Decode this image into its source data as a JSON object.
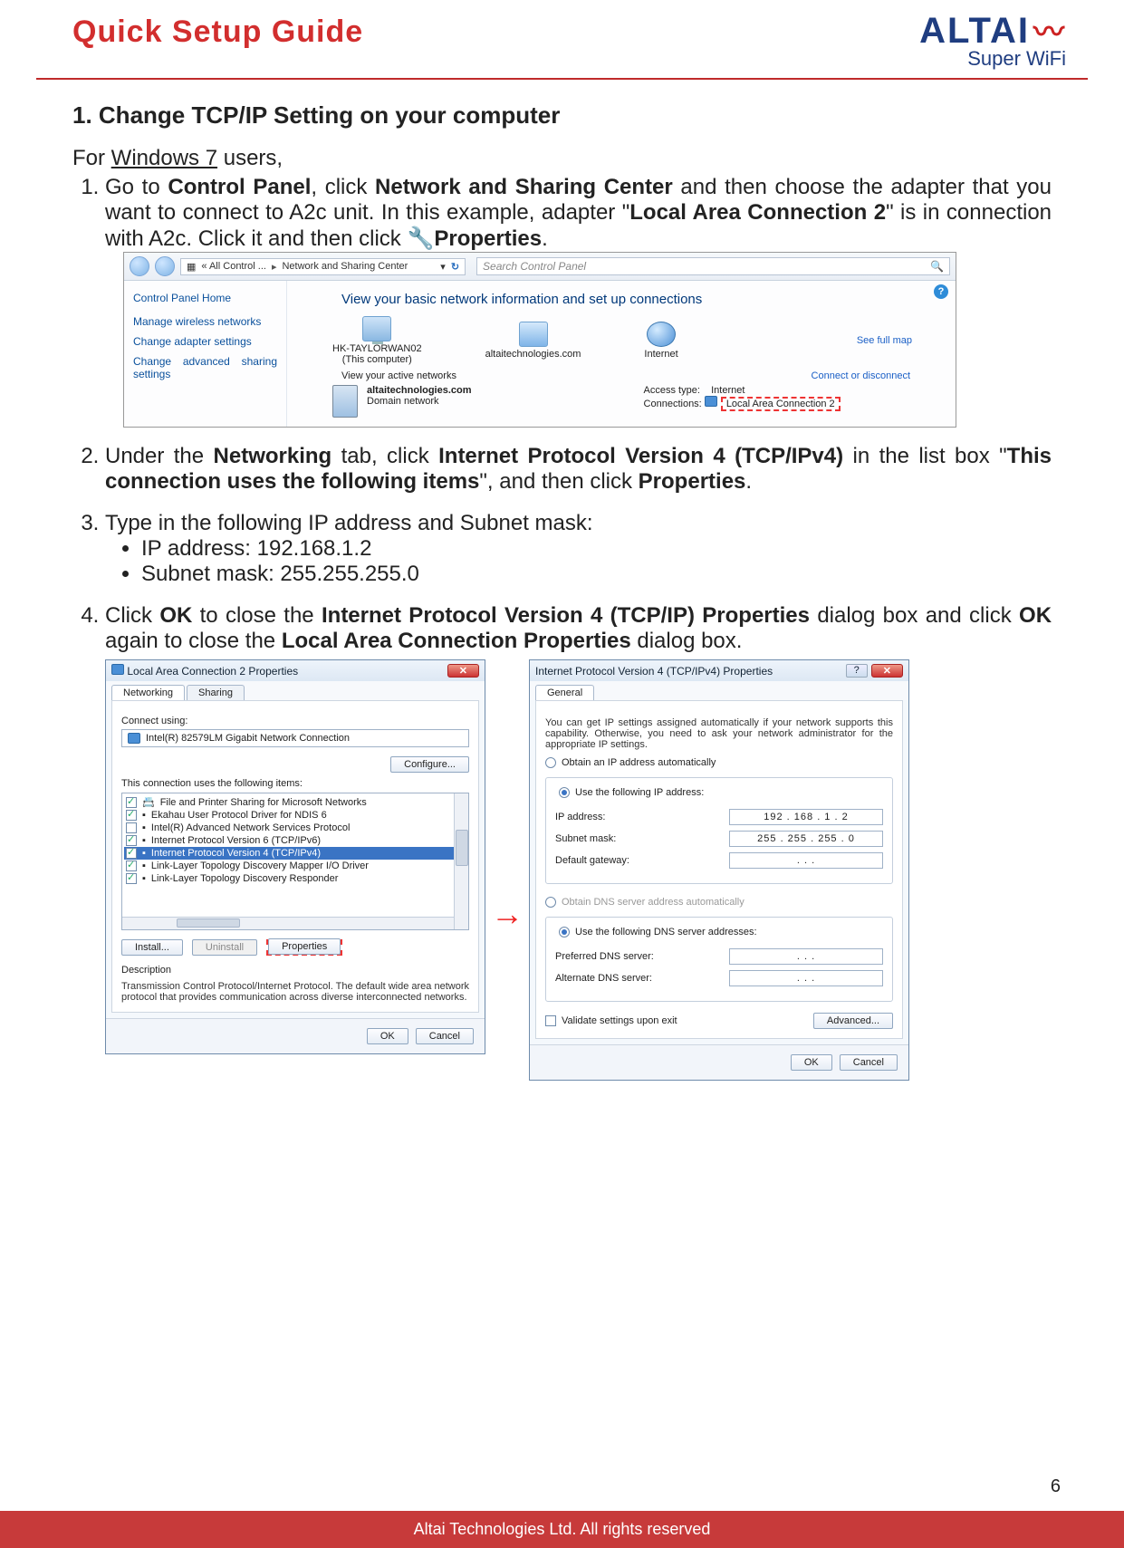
{
  "header": {
    "title": "Quick Setup Guide",
    "brand": "ALTAI",
    "brand_sub": "Super WiFi"
  },
  "section": {
    "heading": "1. Change TCP/IP Setting on your computer"
  },
  "intro": {
    "prefix": "For ",
    "os": "Windows 7",
    "suffix": " users,"
  },
  "step1": {
    "text_a": "Go to ",
    "b1": "Control Panel",
    "text_b": ", click ",
    "b2": "Network and Sharing Center",
    "text_c": " and then choose the adapter that you want to connect to A2c unit. In this example, adapter \"",
    "b3": "Local Area Connection 2",
    "text_d": "\" is in connection with A2c. Click it and then click ",
    "b4": "Properties",
    "text_e": "."
  },
  "ss1": {
    "breadcrumb_a": "« All Control ...",
    "breadcrumb_b": "Network and Sharing Center",
    "search_ph": "Search Control Panel",
    "side": {
      "home": "Control Panel Home",
      "l1": "Manage wireless networks",
      "l2": "Change adapter settings",
      "l3": "Change advanced sharing settings"
    },
    "main_title": "View your basic network information and set up connections",
    "see_map": "See full map",
    "n1_a": "HK-TAYLORWAN02",
    "n1_b": "(This computer)",
    "n2": "altaitechnologies.com",
    "n3": "Internet",
    "view_active": "View your active networks",
    "connect_link": "Connect or disconnect",
    "dom": "altaitechnologies.com",
    "dom_sub": "Domain network",
    "access_lbl": "Access type:",
    "access_val": "Internet",
    "conn_lbl": "Connections:",
    "conn_val": "Local Area Connection 2"
  },
  "step2": {
    "text_a": "Under the ",
    "b1": "Networking",
    "text_b": " tab, click ",
    "b2": "Internet Protocol Version 4 (TCP/IPv4)",
    "text_c": " in the list box \"",
    "b3": "This connection uses the following items",
    "text_d": "\", and then click ",
    "b4": "Properties",
    "text_e": "."
  },
  "step3": {
    "text": "Type in the following IP address and Subnet mask:",
    "ip_lbl": "IP address: 192.168.1.2",
    "mask_lbl": "Subnet mask: 255.255.255.0"
  },
  "step4": {
    "text_a": "Click ",
    "b1": "OK",
    "text_b": " to close the ",
    "b2": "Internet Protocol Version 4 (TCP/IP) Properties",
    "text_c": " dialog box and click ",
    "b3": "OK",
    "text_d": " again to close the ",
    "b4": "Local Area Connection Properties",
    "text_e": " dialog box."
  },
  "ss2": {
    "title": "Local Area Connection 2 Properties",
    "tab1": "Networking",
    "tab2": "Sharing",
    "connect_using": "Connect using:",
    "nic": "Intel(R) 82579LM Gigabit Network Connection",
    "configure": "Configure...",
    "items_lbl": "This connection uses the following items:",
    "items": [
      "File and Printer Sharing for Microsoft Networks",
      "Ekahau User Protocol Driver for NDIS 6",
      "Intel(R) Advanced Network Services Protocol",
      "Internet Protocol Version 6 (TCP/IPv6)",
      "Internet Protocol Version 4 (TCP/IPv4)",
      "Link-Layer Topology Discovery Mapper I/O Driver",
      "Link-Layer Topology Discovery Responder"
    ],
    "install": "Install...",
    "uninstall": "Uninstall",
    "properties": "Properties",
    "desc_lbl": "Description",
    "desc": "Transmission Control Protocol/Internet Protocol. The default wide area network protocol that provides communication across diverse interconnected networks.",
    "ok": "OK",
    "cancel": "Cancel"
  },
  "ss3": {
    "title": "Internet Protocol Version 4 (TCP/IPv4) Properties",
    "tab": "General",
    "info": "You can get IP settings assigned automatically if your network supports this capability. Otherwise, you need to ask your network administrator for the appropriate IP settings.",
    "r1": "Obtain an IP address automatically",
    "r2": "Use the following IP address:",
    "ip_lbl": "IP address:",
    "ip_val": "192 . 168 .  1  .  2",
    "mask_lbl": "Subnet mask:",
    "mask_val": "255 . 255 . 255 .  0",
    "gw_lbl": "Default gateway:",
    "gw_val": ".        .        .",
    "r3": "Obtain DNS server address automatically",
    "r4": "Use the following DNS server addresses:",
    "dns1_lbl": "Preferred DNS server:",
    "dns1_val": ".        .        .",
    "dns2_lbl": "Alternate DNS server:",
    "dns2_val": ".        .        .",
    "validate": "Validate settings upon exit",
    "advanced": "Advanced...",
    "ok": "OK",
    "cancel": "Cancel"
  },
  "arrow": "→",
  "page_num": "6",
  "footer": "Altai Technologies Ltd. All rights reserved"
}
